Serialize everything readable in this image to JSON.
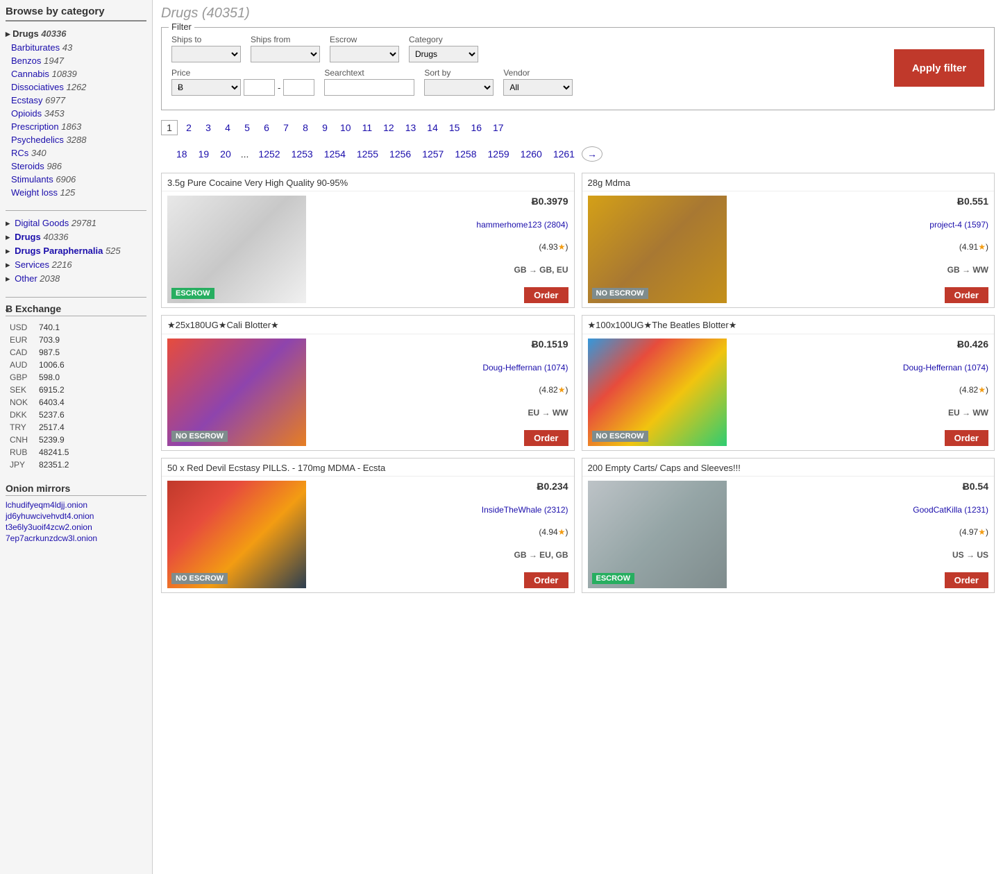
{
  "sidebar": {
    "title": "Browse by category",
    "categories": [
      {
        "label": "Drugs",
        "count": "40336",
        "active": true,
        "indent": 0
      },
      {
        "label": "Barbiturates",
        "count": "43",
        "active": false,
        "indent": 1
      },
      {
        "label": "Benzos",
        "count": "1947",
        "active": false,
        "indent": 1
      },
      {
        "label": "Cannabis",
        "count": "10839",
        "active": false,
        "indent": 1
      },
      {
        "label": "Dissociatives",
        "count": "1262",
        "active": false,
        "indent": 1
      },
      {
        "label": "Ecstasy",
        "count": "6977",
        "active": false,
        "indent": 1
      },
      {
        "label": "Opioids",
        "count": "3453",
        "active": false,
        "indent": 1
      },
      {
        "label": "Prescription",
        "count": "1863",
        "active": false,
        "indent": 1
      },
      {
        "label": "Psychedelics",
        "count": "3288",
        "active": false,
        "indent": 1
      },
      {
        "label": "RCs",
        "count": "340",
        "active": false,
        "indent": 1
      },
      {
        "label": "Steroids",
        "count": "986",
        "active": false,
        "indent": 1
      },
      {
        "label": "Stimulants",
        "count": "6906",
        "active": false,
        "indent": 1
      },
      {
        "label": "Weight loss",
        "count": "125",
        "active": false,
        "indent": 1
      }
    ],
    "main_categories": [
      {
        "label": "Digital Goods",
        "count": "29781"
      },
      {
        "label": "Drugs",
        "count": "40336"
      },
      {
        "label": "Drugs Paraphernalia",
        "count": "525"
      },
      {
        "label": "Services",
        "count": "2216"
      },
      {
        "label": "Other",
        "count": "2038"
      }
    ],
    "exchange_title": "Ƀ Exchange",
    "exchange": [
      {
        "currency": "USD",
        "value": "740.1"
      },
      {
        "currency": "EUR",
        "value": "703.9"
      },
      {
        "currency": "CAD",
        "value": "987.5"
      },
      {
        "currency": "AUD",
        "value": "1006.6"
      },
      {
        "currency": "GBP",
        "value": "598.0"
      },
      {
        "currency": "SEK",
        "value": "6915.2"
      },
      {
        "currency": "NOK",
        "value": "6403.4"
      },
      {
        "currency": "DKK",
        "value": "5237.6"
      },
      {
        "currency": "TRY",
        "value": "2517.4"
      },
      {
        "currency": "CNH",
        "value": "5239.9"
      },
      {
        "currency": "RUB",
        "value": "48241.5"
      },
      {
        "currency": "JPY",
        "value": "82351.2"
      }
    ],
    "onion_title": "Onion mirrors",
    "onion_links": [
      "lchudifyeqm4ldjj.onion",
      "jd6yhuwcivehvdt4.onion",
      "t3e6ly3uoif4zcw2.onion",
      "7ep7acrkunzdcw3l.onion"
    ]
  },
  "main": {
    "heading": "Drugs (40351)",
    "filter": {
      "legend": "Filter",
      "ships_to_label": "Ships to",
      "ships_from_label": "Ships from",
      "escrow_label": "Escrow",
      "category_label": "Category",
      "category_value": "Drugs",
      "price_label": "Price",
      "price_currency": "Ƀ",
      "searchtext_label": "Searchtext",
      "sort_by_label": "Sort by",
      "vendor_label": "Vendor",
      "vendor_value": "All",
      "apply_label": "Apply filter"
    },
    "pagination_row1": [
      "1",
      "2",
      "3",
      "4",
      "5",
      "6",
      "7",
      "8",
      "9",
      "10",
      "11",
      "12",
      "13",
      "14",
      "15",
      "16",
      "17"
    ],
    "pagination_row2": [
      "18",
      "19",
      "20",
      "...",
      "1252",
      "1253",
      "1254",
      "1255",
      "1256",
      "1257",
      "1258",
      "1259",
      "1260",
      "1261"
    ],
    "products": [
      {
        "title": "3.5g Pure Cocaine Very High Quality 90-95%",
        "price": "Ƀ0.3979",
        "vendor": "hammerhome123 (2804)",
        "rating": "(4.93★)",
        "ship": "GB → GB, EU",
        "escrow": "ESCROW",
        "escrow_type": "escrow",
        "img_class": "img-cocaine"
      },
      {
        "title": "28g Mdma",
        "price": "Ƀ0.551",
        "vendor": "project-4 (1597) (4.91★)",
        "rating": "",
        "ship": "GB → WW",
        "escrow": "NO ESCROW",
        "escrow_type": "noescrow",
        "img_class": "img-mdma"
      },
      {
        "title": "★25x180UG★Cali Blotter★",
        "price": "Ƀ0.1519",
        "vendor": "Doug-Heffernan (1074)",
        "rating": "(4.82★)",
        "ship": "EU → WW",
        "escrow": "NO ESCROW",
        "escrow_type": "noescrow",
        "img_class": "img-blotter1"
      },
      {
        "title": "★100x100UG★The Beatles Blotter★",
        "price": "Ƀ0.426",
        "vendor": "Doug-Heffernan (1074)",
        "rating": "(4.82★)",
        "ship": "EU → WW",
        "escrow": "NO ESCROW",
        "escrow_type": "noescrow",
        "img_class": "img-blotter2"
      },
      {
        "title": "50 x Red Devil Ecstasy PILLS. - 170mg MDMA - Ecsta",
        "price": "Ƀ0.234",
        "vendor": "InsideTheWhale (2312)",
        "rating": "(4.94★)",
        "ship": "GB → EU, GB",
        "escrow": "NO ESCROW",
        "escrow_type": "noescrow",
        "img_class": "img-pills"
      },
      {
        "title": "200 Empty Carts/ Caps and Sleeves!!!",
        "price": "Ƀ0.54",
        "vendor": "GoodCatKilla (1231) (4.97★)",
        "rating": "",
        "ship": "US → US",
        "escrow": "ESCROW",
        "escrow_type": "escrow",
        "img_class": "img-carts"
      }
    ],
    "order_label": "Order"
  }
}
